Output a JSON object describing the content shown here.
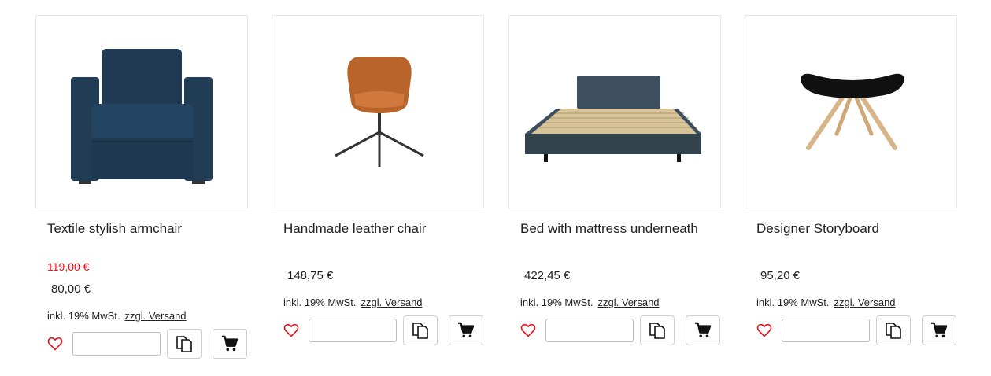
{
  "colors": {
    "heart": "#e4161c",
    "old_price": "#e4161c",
    "border": "#e8e8e8"
  },
  "products": [
    {
      "name": "Textile stylish armchair",
      "old_price": "119,00 €",
      "price": "80,00 €",
      "tax_label": "inkl. 19% MwSt.",
      "shipping_label": "zzgl. Versand",
      "image": "blue-armchair",
      "wishlist_icon": "heart-icon",
      "compare_icon": "compare-icon",
      "cart_icon": "cart-icon"
    },
    {
      "name": "Handmade leather chair",
      "old_price": "",
      "price": "148,75 €",
      "tax_label": "inkl. 19% MwSt.",
      "shipping_label": "zzgl. Versand",
      "image": "leather-swivel-chair",
      "wishlist_icon": "heart-icon",
      "compare_icon": "compare-icon",
      "cart_icon": "cart-icon"
    },
    {
      "name": "Bed with mattress underneath",
      "old_price": "",
      "price": "422,45 €",
      "tax_label": "inkl. 19% MwSt.",
      "shipping_label": "zzgl. Versand",
      "image": "slatted-bed",
      "wishlist_icon": "heart-icon",
      "compare_icon": "compare-icon",
      "cart_icon": "cart-icon"
    },
    {
      "name": "Designer Storyboard",
      "old_price": "",
      "price": "95,20 €",
      "tax_label": "inkl. 19% MwSt.",
      "shipping_label": "zzgl. Versand",
      "image": "designer-stool",
      "wishlist_icon": "heart-icon",
      "compare_icon": "compare-icon",
      "cart_icon": "cart-icon"
    }
  ]
}
